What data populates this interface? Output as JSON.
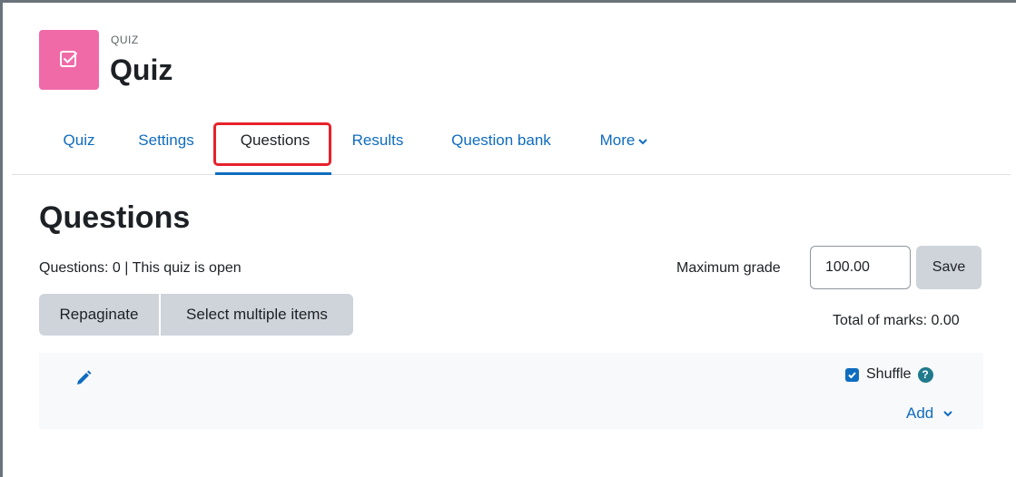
{
  "header": {
    "module_type": "QUIZ",
    "title": "Quiz",
    "icon": "quiz-checkbox-icon",
    "accent": "#f06aa8"
  },
  "tabs": [
    {
      "label": "Quiz",
      "active": false
    },
    {
      "label": "Settings",
      "active": false
    },
    {
      "label": "Questions",
      "active": true
    },
    {
      "label": "Results",
      "active": false
    },
    {
      "label": "Question bank",
      "active": false
    },
    {
      "label": "More",
      "active": false
    }
  ],
  "page": {
    "heading": "Questions",
    "status": "Questions: 0 | This quiz is open",
    "repaginate_label": "Repaginate",
    "select_multiple_label": "Select multiple items",
    "maximum_grade_label": "Maximum grade",
    "maximum_grade_value": "100.00",
    "save_label": "Save",
    "total_marks": "Total of marks: 0.00"
  },
  "section": {
    "shuffle_label": "Shuffle",
    "shuffle_checked": true,
    "help_glyph": "?",
    "add_label": "Add"
  },
  "colors": {
    "link": "#0f6cbf",
    "highlight": "#e8212b",
    "button_bg": "#ced4da",
    "help": "#1f7a8c"
  }
}
